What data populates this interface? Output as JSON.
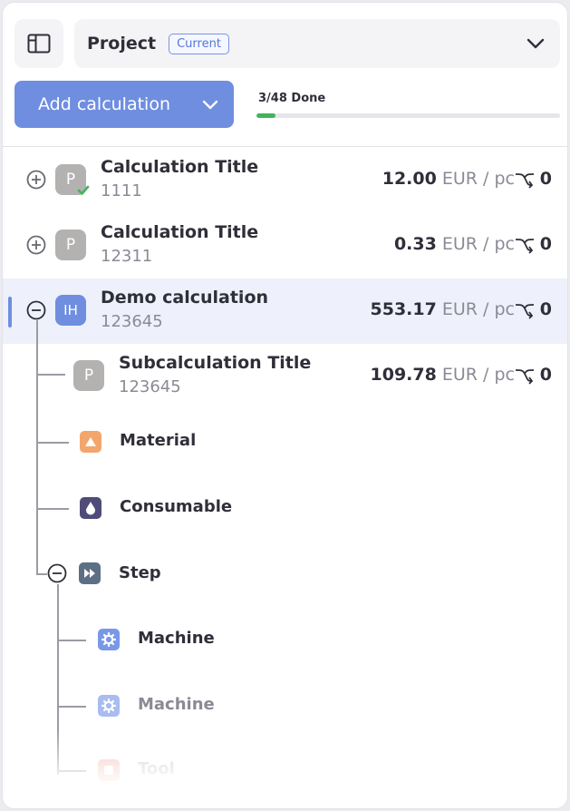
{
  "header": {
    "project_label": "Project",
    "project_badge": "Current",
    "add_button_label": "Add calculation",
    "progress_text": "3/48 Done",
    "progress_fraction": 0.0625
  },
  "colors": {
    "accent": "#6f8ee0",
    "progress": "#3fb55a",
    "material": "#f2a66c",
    "consumable": "#4f4c7a",
    "step": "#5d6f84",
    "machine": "#7a98e8"
  },
  "tree": [
    {
      "avatar": "P",
      "title": "Calculation Title",
      "id": "1111",
      "price": "12.00",
      "unit": "EUR / pc",
      "count": "0",
      "icon": "plus-circle-icon"
    },
    {
      "avatar": "P",
      "title": "Calculation Title",
      "id": "12311",
      "price": "0.33",
      "unit": "EUR / pc",
      "count": "0",
      "icon": "plus-circle-icon"
    },
    {
      "avatar": "IH",
      "title": "Demo calculation",
      "id": "123645",
      "price": "553.17",
      "unit": "EUR / pc",
      "count": "0",
      "icon": "minus-circle-icon",
      "selected": true
    },
    {
      "avatar": "P",
      "title": "Subcalculation Title",
      "id": "123645",
      "price": "109.78",
      "unit": "EUR / pc",
      "count": "0"
    }
  ],
  "items": {
    "material": "Material",
    "consumable": "Consumable",
    "step": "Step",
    "machine_1": "Machine",
    "machine_2": "Machine",
    "tool": "Tool"
  }
}
